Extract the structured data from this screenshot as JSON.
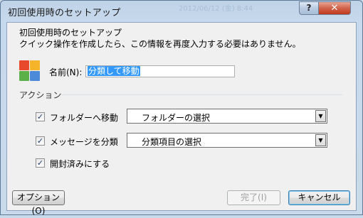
{
  "window": {
    "title": "初回使用時のセットアップ",
    "help_label": "?",
    "close_label": "✕",
    "background_text": "2012/06/12 (金) 8:44"
  },
  "dialog": {
    "heading": "初回使用時のセットアップ",
    "description": "クイック操作を作成したら、この情報を再度入力する必要はありません。",
    "app_icon": "quick-steps-icon",
    "icon_colors": [
      "#e8482c",
      "#f5b42a",
      "#5bb04a",
      "#4a8ad8"
    ],
    "name_label": "名前(N):",
    "name_value": "分類して移動"
  },
  "actions": {
    "title": "アクション",
    "items": [
      {
        "label": "フォルダーへ移動",
        "checked": true,
        "combo_value": "フォルダーの選択"
      },
      {
        "label": "メッセージを分類",
        "checked": true,
        "combo_value": "分類項目の選択"
      },
      {
        "label": "開封済みにする",
        "checked": true
      }
    ]
  },
  "buttons": {
    "options": "オプション(O)",
    "finish": "完了(I)",
    "cancel": "キャンセル"
  }
}
